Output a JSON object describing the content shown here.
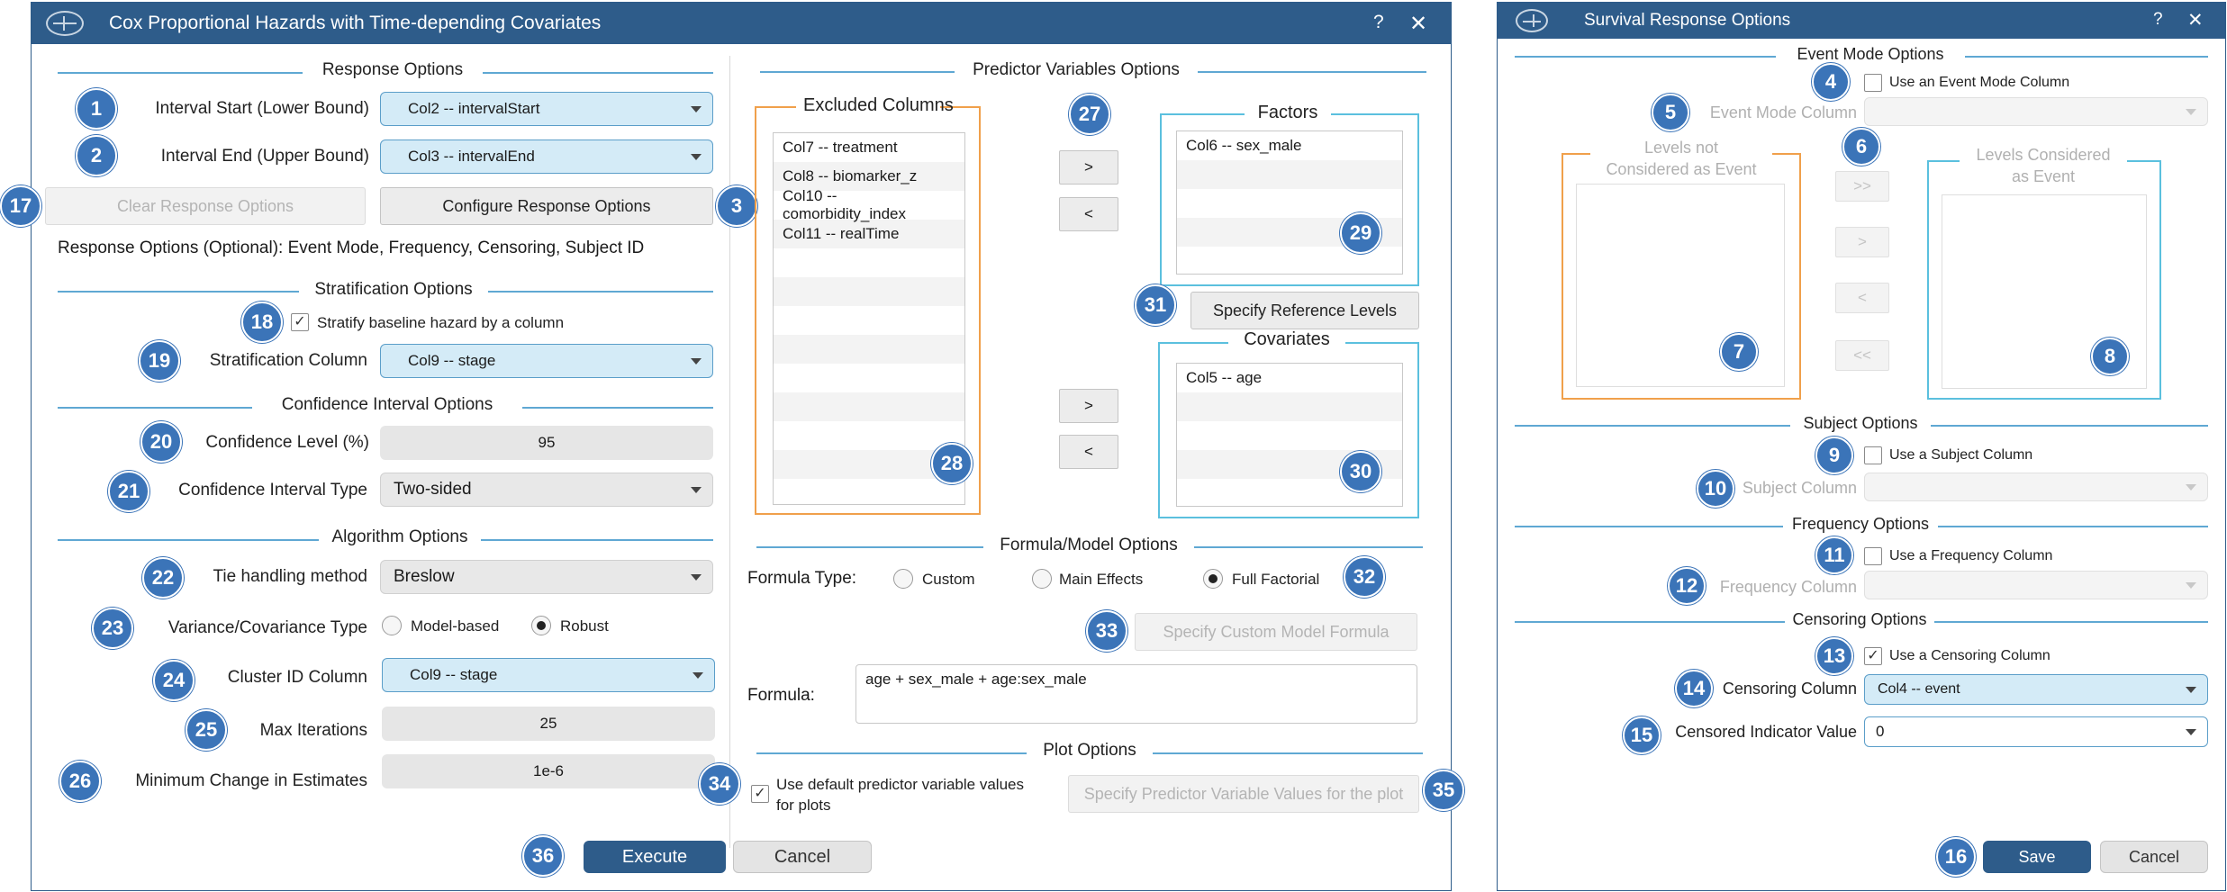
{
  "main": {
    "title": "Cox Proportional Hazards with Time-depending Covariates",
    "help": "?",
    "close": "✕",
    "response": {
      "section": "Response Options",
      "interval_start_label": "Interval Start (Lower Bound)",
      "interval_start_value": "Col2 -- intervalStart",
      "interval_end_label": "Interval End (Upper Bound)",
      "interval_end_value": "Col3 -- intervalEnd",
      "clear_button": "Clear Response Options",
      "configure_button": "Configure Response Options",
      "note": "Response Options (Optional): Event Mode, Frequency, Censoring, Subject ID"
    },
    "stratification": {
      "section": "Stratification Options",
      "checkbox_label": "Stratify baseline hazard by a column",
      "column_label": "Stratification Column",
      "column_value": "Col9 -- stage"
    },
    "confidence": {
      "section": "Confidence Interval Options",
      "level_label": "Confidence Level (%)",
      "level_value": "95",
      "type_label": "Confidence Interval Type",
      "type_value": "Two-sided"
    },
    "algorithm": {
      "section": "Algorithm Options",
      "tie_label": "Tie handling method",
      "tie_value": "Breslow",
      "variance_label": "Variance/Covariance Type",
      "variance_opt1": "Model-based",
      "variance_opt2": "Robust",
      "cluster_label": "Cluster ID Column",
      "cluster_value": "Col9 -- stage",
      "maxiter_label": "Max Iterations",
      "maxiter_value": "25",
      "minchange_label": "Minimum Change in Estimates",
      "minchange_value": "1e-6"
    },
    "predictors": {
      "section": "Predictor Variables Options",
      "excluded_title": "Excluded Columns",
      "excluded": [
        "Col7 -- treatment",
        "Col8 -- biomarker_z",
        "Col10 -- comorbidity_index",
        "Col11 -- realTime"
      ],
      "factors_title": "Factors",
      "factors": [
        "Col6 -- sex_male"
      ],
      "covariates_title": "Covariates",
      "covariates": [
        "Col5 -- age"
      ],
      "move_right": ">",
      "move_left": "<",
      "ref_levels_button": "Specify Reference Levels"
    },
    "formula": {
      "section": "Formula/Model Options",
      "type_label": "Formula Type:",
      "opt_custom": "Custom",
      "opt_main": "Main Effects",
      "opt_full": "Full Factorial",
      "custom_button": "Specify Custom Model Formula",
      "formula_label": "Formula:",
      "formula_value": "age + sex_male + age:sex_male"
    },
    "plot": {
      "section": "Plot Options",
      "checkbox_label_1": "Use default predictor variable values",
      "checkbox_label_2": "for plots",
      "specify_button": "Specify Predictor Variable Values for the plot"
    },
    "execute": "Execute",
    "cancel": "Cancel"
  },
  "dialog": {
    "title": "Survival Response Options",
    "help": "?",
    "close": "✕",
    "event_mode": {
      "section": "Event Mode Options",
      "checkbox_label": "Use an Event Mode Column",
      "column_label": "Event Mode Column",
      "not_event_title_1": "Levels not",
      "not_event_title_2": "Considered as Event",
      "event_title_1": "Levels Considered",
      "event_title_2": "as Event",
      "btn_all_right": ">>",
      "btn_right": ">",
      "btn_left": "<",
      "btn_all_left": "<<"
    },
    "subject": {
      "section": "Subject Options",
      "checkbox_label": "Use a Subject Column",
      "column_label": "Subject Column"
    },
    "frequency": {
      "section": "Frequency Options",
      "checkbox_label": "Use a Frequency Column",
      "column_label": "Frequency Column"
    },
    "censoring": {
      "section": "Censoring Options",
      "checkbox_label": "Use a Censoring Column",
      "column_label": "Censoring Column",
      "column_value": "Col4 -- event",
      "indicator_label": "Censored Indicator Value",
      "indicator_value": "0"
    },
    "save": "Save",
    "cancel": "Cancel"
  },
  "badges": [
    "1",
    "2",
    "3",
    "4",
    "5",
    "6",
    "7",
    "8",
    "9",
    "10",
    "11",
    "12",
    "13",
    "14",
    "15",
    "16",
    "17",
    "18",
    "19",
    "20",
    "21",
    "22",
    "23",
    "24",
    "25",
    "26",
    "27",
    "28",
    "29",
    "30",
    "31",
    "32",
    "33",
    "34",
    "35",
    "36"
  ],
  "colors": {
    "titlebar": "#2e5c8a",
    "badge": "#3b74b8",
    "section_line": "#5fa8d3",
    "excluded_border": "#f0a04b",
    "selected_border": "#5bc0de",
    "dropdown_fill": "#d4ebf7"
  }
}
